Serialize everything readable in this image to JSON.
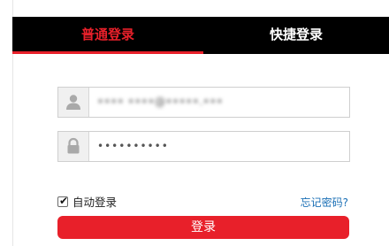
{
  "tabs": {
    "normal_label": "普通登录",
    "quick_label": "快捷登录"
  },
  "form": {
    "username_value": "•••• ••••@•••••.•••",
    "password_value": "••••••••••"
  },
  "remember": {
    "label": "自动登录",
    "checked": true
  },
  "forgot_label": "忘记密码?",
  "login_button_label": "登录",
  "colors": {
    "accent": "#e8202a",
    "tab_bar": "#000000",
    "link": "#1a6fb5"
  },
  "icons": {
    "username": "user-icon",
    "password": "lock-icon",
    "checkbox": "check-icon"
  }
}
